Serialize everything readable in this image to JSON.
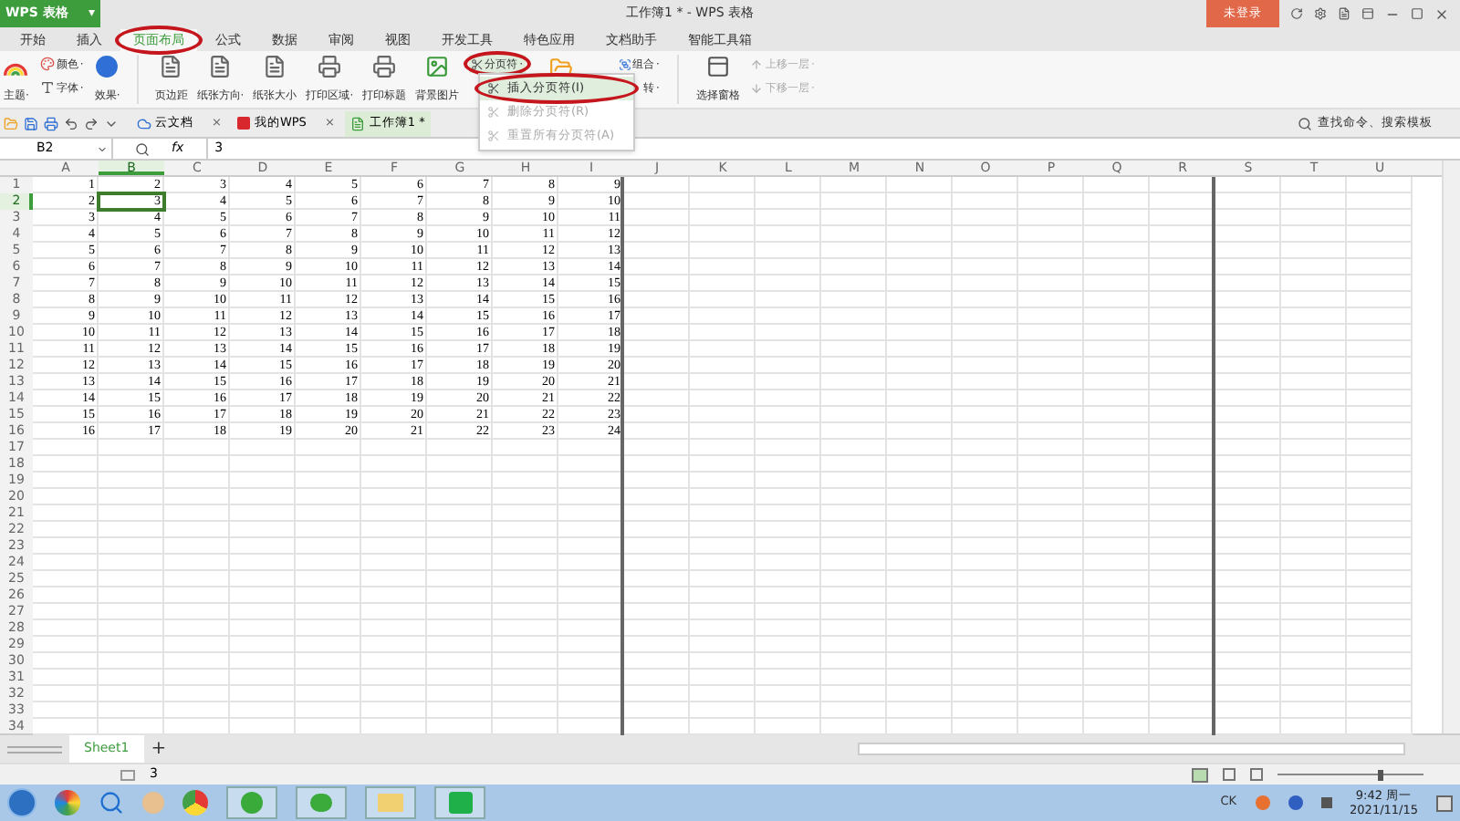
{
  "app_button": {
    "label": "WPS 表格",
    "caret": "▾"
  },
  "window": {
    "title": "工作簿1 * - WPS 表格",
    "login": "未登录"
  },
  "tabs": [
    {
      "label": "开始",
      "selected": false,
      "circled": false
    },
    {
      "label": "插入",
      "selected": false,
      "circled": false
    },
    {
      "label": "页面布局",
      "selected": true,
      "circled": true
    },
    {
      "label": "公式",
      "selected": false,
      "circled": false
    },
    {
      "label": "数据",
      "selected": false,
      "circled": false
    },
    {
      "label": "审阅",
      "selected": false,
      "circled": false
    },
    {
      "label": "视图",
      "selected": false,
      "circled": false
    },
    {
      "label": "开发工具",
      "selected": false,
      "circled": false
    },
    {
      "label": "特色应用",
      "selected": false,
      "circled": false
    },
    {
      "label": "文档助手",
      "selected": false,
      "circled": false
    },
    {
      "label": "智能工具箱",
      "selected": false,
      "circled": false
    }
  ],
  "ribbon": [
    {
      "kind": "large",
      "label": "主题",
      "caret": "·"
    },
    {
      "kind": "stack",
      "items": [
        {
          "label": "颜色",
          "caret": "·",
          "disabled": false,
          "circled": false
        },
        {
          "label": "字体",
          "caret": "·",
          "disabled": false,
          "circled": false
        }
      ]
    },
    {
      "kind": "large",
      "label": "效果",
      "caret": "·"
    },
    {
      "kind": "separator"
    },
    {
      "kind": "large",
      "label": "页边距"
    },
    {
      "kind": "large",
      "label": "纸张方向",
      "caret": "·"
    },
    {
      "kind": "large",
      "label": "纸张大小"
    },
    {
      "kind": "large",
      "label": "打印区域",
      "caret": "·"
    },
    {
      "kind": "large",
      "label": "打印标题"
    },
    {
      "kind": "large",
      "label": "背景图片"
    },
    {
      "kind": "stack",
      "items": [
        {
          "label": "分页符",
          "caret": "·",
          "disabled": false,
          "circled": true
        }
      ]
    },
    {
      "kind": "icon"
    },
    {
      "kind": "stack",
      "items": [
        {
          "label": "组合",
          "caret": "·",
          "disabled": false,
          "circled": false
        },
        {
          "label": "转",
          "caret": "·",
          "disabled": false,
          "circled": false
        }
      ]
    },
    {
      "kind": "separator"
    },
    {
      "kind": "large",
      "label": "选择窗格"
    },
    {
      "kind": "stack",
      "items": [
        {
          "label": "上移一层",
          "caret": "·",
          "disabled": true,
          "circled": false
        },
        {
          "label": "下移一层",
          "caret": "·",
          "disabled": true,
          "circled": false
        }
      ]
    }
  ],
  "menu": [
    {
      "label": "插入分页符(I)",
      "disabled": false,
      "circled": true
    },
    {
      "label": "删除分页符(R)",
      "disabled": true,
      "circled": false
    },
    {
      "label": "重置所有分页符(A)",
      "disabled": true,
      "circled": false
    }
  ],
  "doc_tabs": [
    {
      "label": "云文档",
      "selected": false,
      "close": "×"
    },
    {
      "label": "我的WPS",
      "selected": false,
      "close": "×"
    },
    {
      "label": "工作簿1 *",
      "selected": true
    }
  ],
  "search": {
    "placeholder": "查找命令、搜索模板"
  },
  "formula": {
    "cell": "B2",
    "fx": "fx",
    "value": "3"
  },
  "columns": [
    {
      "label": "A",
      "selected": false,
      "page_break": false
    },
    {
      "label": "B",
      "selected": true,
      "page_break": false
    },
    {
      "label": "C",
      "selected": false,
      "page_break": false
    },
    {
      "label": "D",
      "selected": false,
      "page_break": false
    },
    {
      "label": "E",
      "selected": false,
      "page_break": false
    },
    {
      "label": "F",
      "selected": false,
      "page_break": false
    },
    {
      "label": "G",
      "selected": false,
      "page_break": false
    },
    {
      "label": "H",
      "selected": false,
      "page_break": false
    },
    {
      "label": "I",
      "selected": false,
      "page_break": true
    },
    {
      "label": "J",
      "selected": false,
      "page_break": false
    },
    {
      "label": "K",
      "selected": false,
      "page_break": false
    },
    {
      "label": "L",
      "selected": false,
      "page_break": false
    },
    {
      "label": "M",
      "selected": false,
      "page_break": false
    },
    {
      "label": "N",
      "selected": false,
      "page_break": false
    },
    {
      "label": "O",
      "selected": false,
      "page_break": false
    },
    {
      "label": "P",
      "selected": false,
      "page_break": false
    },
    {
      "label": "Q",
      "selected": false,
      "page_break": false
    },
    {
      "label": "R",
      "selected": false,
      "page_break": true
    },
    {
      "label": "S",
      "selected": false,
      "page_break": false
    },
    {
      "label": "T",
      "selected": false,
      "page_break": false
    },
    {
      "label": "U",
      "selected": false,
      "page_break": false
    }
  ],
  "rows": [
    {
      "header": "1",
      "selected": false,
      "cells": [
        "1",
        "2",
        "3",
        "4",
        "5",
        "6",
        "7",
        "8",
        "9"
      ]
    },
    {
      "header": "2",
      "selected": true,
      "cells": [
        "2",
        "3",
        "4",
        "5",
        "6",
        "7",
        "8",
        "9",
        "10"
      ]
    },
    {
      "header": "3",
      "selected": false,
      "cells": [
        "3",
        "4",
        "5",
        "6",
        "7",
        "8",
        "9",
        "10",
        "11"
      ]
    },
    {
      "header": "4",
      "selected": false,
      "cells": [
        "4",
        "5",
        "6",
        "7",
        "8",
        "9",
        "10",
        "11",
        "12"
      ]
    },
    {
      "header": "5",
      "selected": false,
      "cells": [
        "5",
        "6",
        "7",
        "8",
        "9",
        "10",
        "11",
        "12",
        "13"
      ]
    },
    {
      "header": "6",
      "selected": false,
      "cells": [
        "6",
        "7",
        "8",
        "9",
        "10",
        "11",
        "12",
        "13",
        "14"
      ]
    },
    {
      "header": "7",
      "selected": false,
      "cells": [
        "7",
        "8",
        "9",
        "10",
        "11",
        "12",
        "13",
        "14",
        "15"
      ]
    },
    {
      "header": "8",
      "selected": false,
      "cells": [
        "8",
        "9",
        "10",
        "11",
        "12",
        "13",
        "14",
        "15",
        "16"
      ]
    },
    {
      "header": "9",
      "selected": false,
      "cells": [
        "9",
        "10",
        "11",
        "12",
        "13",
        "14",
        "15",
        "16",
        "17"
      ]
    },
    {
      "header": "10",
      "selected": false,
      "cells": [
        "10",
        "11",
        "12",
        "13",
        "14",
        "15",
        "16",
        "17",
        "18"
      ]
    },
    {
      "header": "11",
      "selected": false,
      "cells": [
        "11",
        "12",
        "13",
        "14",
        "15",
        "16",
        "17",
        "18",
        "19"
      ]
    },
    {
      "header": "12",
      "selected": false,
      "cells": [
        "12",
        "13",
        "14",
        "15",
        "16",
        "17",
        "18",
        "19",
        "20"
      ]
    },
    {
      "header": "13",
      "selected": false,
      "cells": [
        "13",
        "14",
        "15",
        "16",
        "17",
        "18",
        "19",
        "20",
        "21"
      ]
    },
    {
      "header": "14",
      "selected": false,
      "cells": [
        "14",
        "15",
        "16",
        "17",
        "18",
        "19",
        "20",
        "21",
        "22"
      ]
    },
    {
      "header": "15",
      "selected": false,
      "cells": [
        "15",
        "16",
        "17",
        "18",
        "19",
        "20",
        "21",
        "22",
        "23"
      ]
    },
    {
      "header": "16",
      "selected": false,
      "cells": [
        "16",
        "17",
        "18",
        "19",
        "20",
        "21",
        "22",
        "23",
        "24"
      ]
    },
    {
      "header": "17",
      "selected": false
    },
    {
      "header": "18",
      "selected": false
    },
    {
      "header": "19",
      "selected": false
    },
    {
      "header": "20",
      "selected": false
    },
    {
      "header": "21",
      "selected": false
    },
    {
      "header": "22",
      "selected": false
    },
    {
      "header": "23",
      "selected": false
    },
    {
      "header": "24",
      "selected": false
    },
    {
      "header": "25",
      "selected": false
    },
    {
      "header": "26",
      "selected": false
    },
    {
      "header": "27",
      "selected": false
    },
    {
      "header": "28",
      "selected": false
    },
    {
      "header": "29",
      "selected": false
    },
    {
      "header": "30",
      "selected": false
    },
    {
      "header": "31",
      "selected": false
    },
    {
      "header": "32",
      "selected": false
    },
    {
      "header": "33",
      "selected": false
    },
    {
      "header": "34",
      "selected": false
    }
  ],
  "sheet_tabs": [
    {
      "label": "Sheet1",
      "selected": true
    }
  ],
  "add_sheet": "+",
  "status": {
    "value": "3"
  },
  "zoom": {
    "level": 0.7
  },
  "taskbar": {
    "lang": "CK",
    "time": "9:42 周一",
    "date": "2021/11/15"
  }
}
